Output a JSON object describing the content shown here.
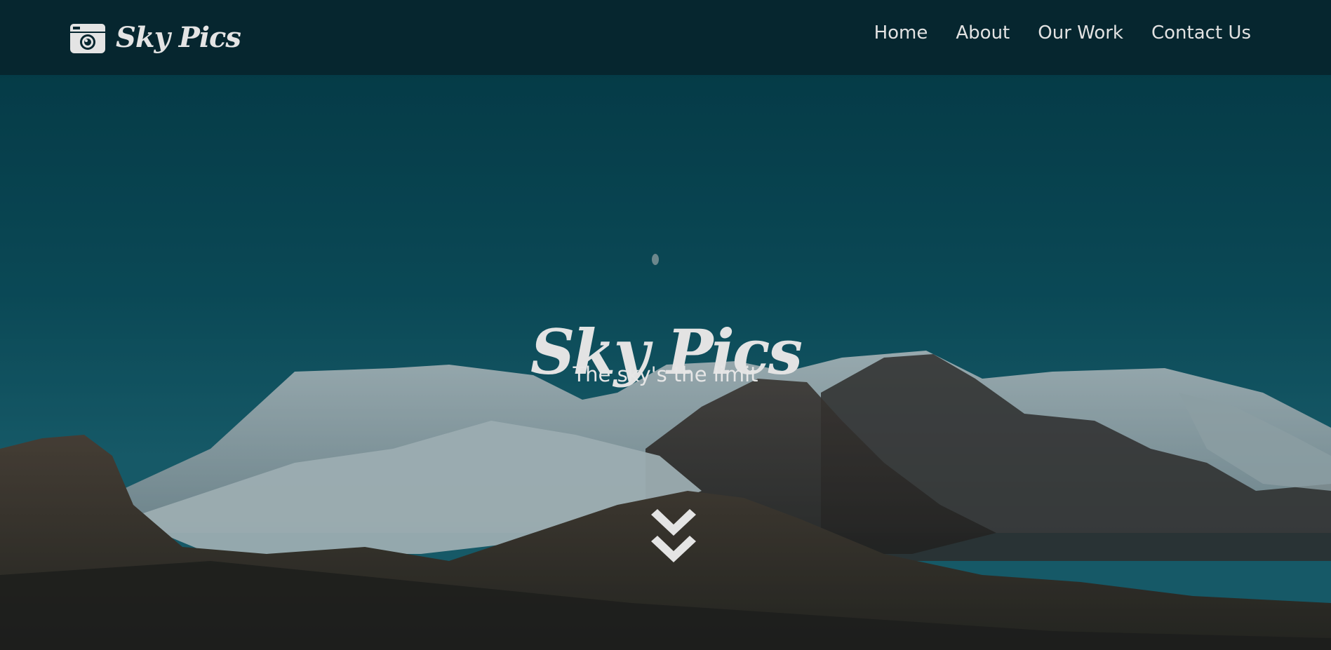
{
  "brand": {
    "name": "Sky Pics",
    "icon": "camera-icon"
  },
  "nav": {
    "items": [
      {
        "label": "Home"
      },
      {
        "label": "About"
      },
      {
        "label": "Our Work"
      },
      {
        "label": "Contact Us"
      }
    ]
  },
  "hero": {
    "title": "Sky Pics",
    "tagline": "The sky's the limit",
    "scroll_icon": "double-chevron-down-icon",
    "background": "mountain-landscape"
  },
  "colors": {
    "navbar": "#06262f",
    "sky_top": "#043f4c",
    "sky_bottom": "#1b6a7a",
    "text": "#e4e4e4"
  }
}
